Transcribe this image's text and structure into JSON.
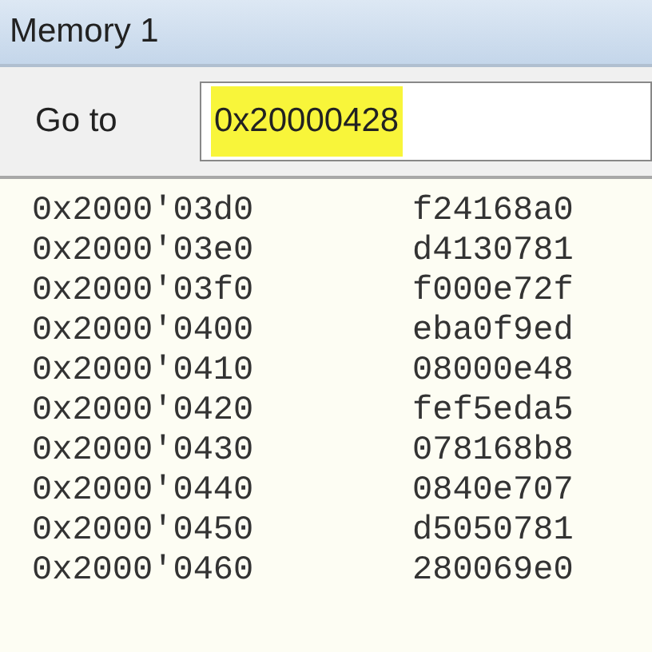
{
  "window": {
    "title": "Memory 1"
  },
  "goto": {
    "label": "Go to",
    "value": "0x20000428",
    "highlighted": true
  },
  "rows": [
    {
      "address": "0x2000'03d0",
      "value": "f24168a0"
    },
    {
      "address": "0x2000'03e0",
      "value": "d4130781"
    },
    {
      "address": "0x2000'03f0",
      "value": "f000e72f"
    },
    {
      "address": "0x2000'0400",
      "value": "eba0f9ed"
    },
    {
      "address": "0x2000'0410",
      "value": "08000e48"
    },
    {
      "address": "0x2000'0420",
      "value": "fef5eda5"
    },
    {
      "address": "0x2000'0430",
      "value": "078168b8"
    },
    {
      "address": "0x2000'0440",
      "value": "0840e707"
    },
    {
      "address": "0x2000'0450",
      "value": "d5050781"
    },
    {
      "address": "0x2000'0460",
      "value": "280069e0"
    }
  ]
}
